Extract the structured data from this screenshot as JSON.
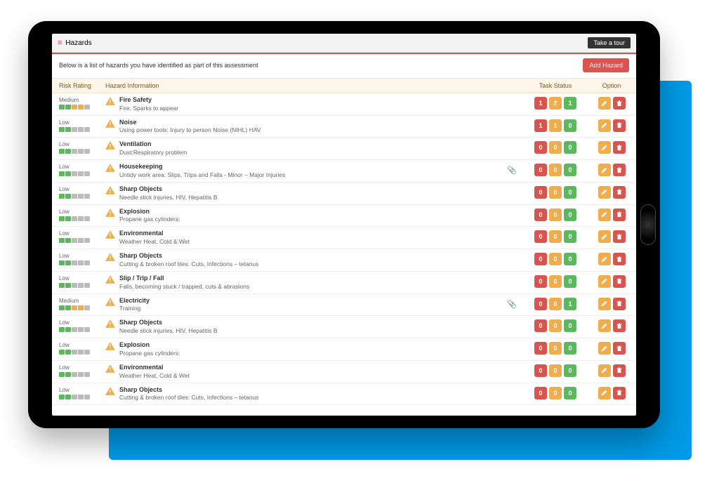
{
  "titlebar": {
    "title": "Hazards",
    "tour_label": "Take a tour"
  },
  "toolbar": {
    "description": "Below is a list of hazards you have identified as part of this assessment",
    "add_label": "Add Hazard"
  },
  "columns": {
    "rating": "Risk Rating",
    "hazard": "Hazard Information",
    "status": "Task Status",
    "option": "Option"
  },
  "rating_patterns": {
    "Medium": [
      "g",
      "g",
      "o",
      "o",
      "x"
    ],
    "Low": [
      "g",
      "g",
      "x",
      "x",
      "x"
    ]
  },
  "rows": [
    {
      "rating": "Medium",
      "title": "Fire Safety",
      "desc": "Fire, Sparks to appear",
      "status": [
        1,
        2,
        1
      ],
      "clip": false
    },
    {
      "rating": "Low",
      "title": "Noise",
      "desc": "Using power tools: Injury to person Noise (NIHL) HAV",
      "status": [
        1,
        1,
        0
      ],
      "clip": false
    },
    {
      "rating": "Low",
      "title": "Ventilation",
      "desc": "Dust:Respiratory problem",
      "status": [
        0,
        0,
        0
      ],
      "clip": false
    },
    {
      "rating": "Low",
      "title": "Housekeeping",
      "desc": "Untidy work area: Slips, Trips and Falls - Minor – Major Injuries",
      "status": [
        0,
        0,
        0
      ],
      "clip": true
    },
    {
      "rating": "Low",
      "title": "Sharp Objects",
      "desc": "Needle stick injuries, HIV, Hepatitis B",
      "status": [
        0,
        0,
        0
      ],
      "clip": false
    },
    {
      "rating": "Low",
      "title": "Explosion",
      "desc": "Propane gas cylinders:",
      "status": [
        0,
        0,
        0
      ],
      "clip": false
    },
    {
      "rating": "Low",
      "title": "Environmental",
      "desc": "Weather Heat, Cold & Wet",
      "status": [
        0,
        0,
        0
      ],
      "clip": false
    },
    {
      "rating": "Low",
      "title": "Sharp Objects",
      "desc": "Cutting & broken roof tiles: Cuts, Infections – tetanus",
      "status": [
        0,
        0,
        0
      ],
      "clip": false
    },
    {
      "rating": "Low",
      "title": "Slip / Trip / Fall",
      "desc": "Falls, becoming stuck / trapped, cuts & abrasions",
      "status": [
        0,
        0,
        0
      ],
      "clip": false
    },
    {
      "rating": "Medium",
      "title": "Electricity",
      "desc": "Training",
      "status": [
        0,
        0,
        1
      ],
      "clip": true
    },
    {
      "rating": "Low",
      "title": "Sharp Objects",
      "desc": "Needle stick injuries, HIV, Hepatitis B",
      "status": [
        0,
        0,
        0
      ],
      "clip": false
    },
    {
      "rating": "Low",
      "title": "Explosion",
      "desc": "Propane gas cylinders:",
      "status": [
        0,
        0,
        0
      ],
      "clip": false
    },
    {
      "rating": "Low",
      "title": "Environmental",
      "desc": "Weather Heat, Cold & Wet",
      "status": [
        0,
        0,
        0
      ],
      "clip": false
    },
    {
      "rating": "Low",
      "title": "Sharp Objects",
      "desc": "Cutting & broken roof tiles: Cuts, Infections – tetanus",
      "status": [
        0,
        0,
        0
      ],
      "clip": false
    }
  ]
}
